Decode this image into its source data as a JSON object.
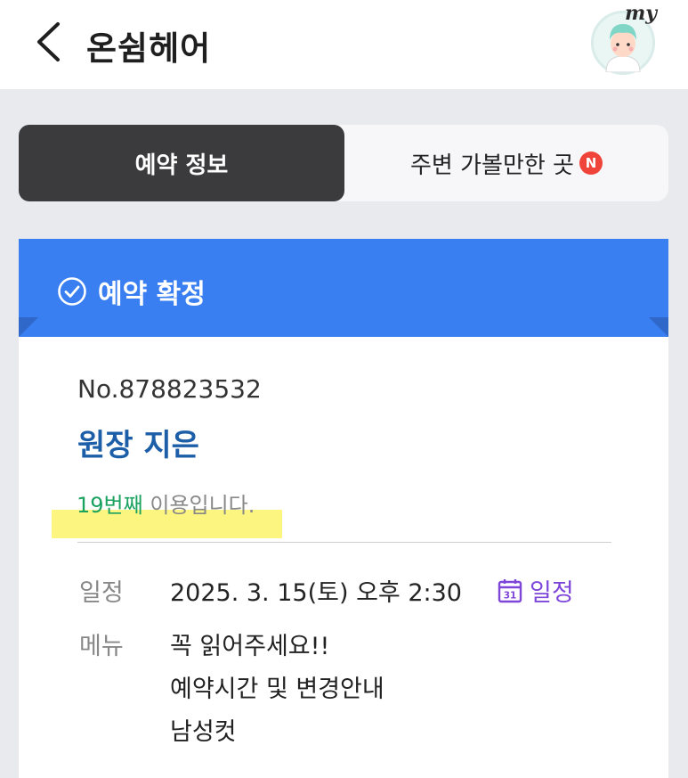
{
  "header": {
    "title": "온쉼헤어",
    "avatar_label": "my"
  },
  "tabs": [
    {
      "label": "예약 정보",
      "active": true
    },
    {
      "label": "주변 가볼만한 곳",
      "badge": "N",
      "active": false
    }
  ],
  "banner": {
    "status": "예약 확정",
    "color": "#3a7ff2"
  },
  "booking": {
    "number": "No.878823532",
    "designer": "원장 지은",
    "visit_count": "19번째",
    "visit_suffix": " 이용입니다.",
    "schedule_label": "일정",
    "schedule_value": "2025. 3. 15(토) 오후 2:30",
    "calendar_day": "31",
    "schedule_link": "일정",
    "menu_label": "메뉴",
    "menu_items": [
      "꼭 읽어주세요!!",
      "예약시간 및 변경안내",
      "남성컷"
    ]
  },
  "colors": {
    "accent_blue": "#3a7ff2",
    "designer_blue": "#1d5ea8",
    "count_green": "#1aa260",
    "link_purple": "#7d46d9",
    "badge_red": "#f0433a",
    "tab_dark": "#3b3b3d"
  },
  "icons": [
    "chevron-left-icon",
    "avatar-icon",
    "check-circle-icon",
    "calendar-icon",
    "new-badge-icon"
  ]
}
